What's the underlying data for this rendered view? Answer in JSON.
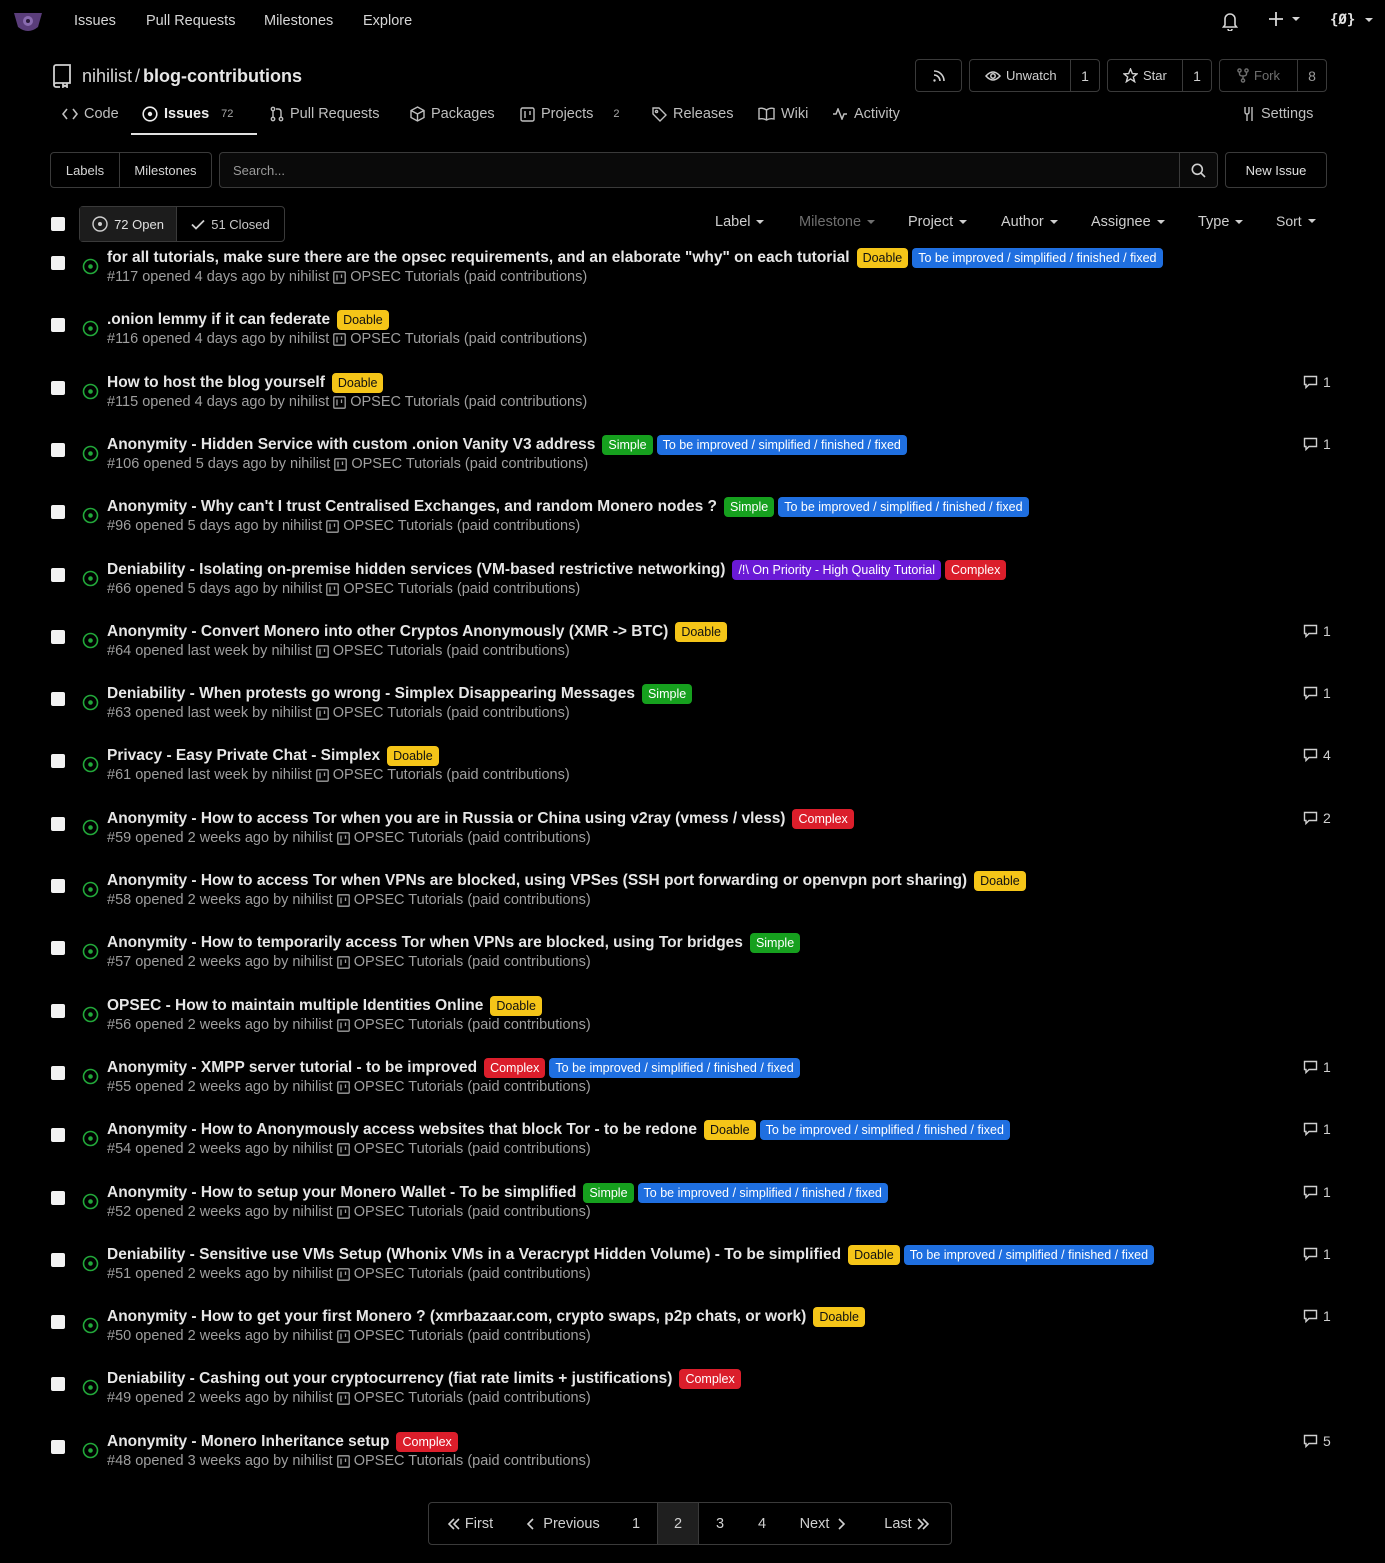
{
  "nav": {
    "links": [
      "Issues",
      "Pull Requests",
      "Milestones",
      "Explore"
    ],
    "user_icon_text": "{Ø}"
  },
  "repo": {
    "owner": "nihilist",
    "separator": "/",
    "name": "blog-contributions",
    "unwatch_label": "Unwatch",
    "watch_count": "1",
    "star_label": "Star",
    "star_count": "1",
    "fork_label": "Fork",
    "fork_count": "8"
  },
  "tabs": {
    "code": "Code",
    "issues": "Issues",
    "issues_count": "72",
    "pulls": "Pull Requests",
    "packages": "Packages",
    "projects": "Projects",
    "projects_count": "2",
    "releases": "Releases",
    "wiki": "Wiki",
    "activity": "Activity",
    "settings": "Settings"
  },
  "toolbar": {
    "labels": "Labels",
    "milestones": "Milestones",
    "search_placeholder": "Search...",
    "new_issue": "New Issue"
  },
  "filters": {
    "open": "72 Open",
    "closed": "51 Closed",
    "label": "Label",
    "milestone": "Milestone",
    "project": "Project",
    "author": "Author",
    "assignee": "Assignee",
    "type": "Type",
    "sort": "Sort"
  },
  "issues": [
    {
      "title": "for all tutorials, make sure there are the opsec requirements, and an elaborate \"why\" on each tutorial",
      "labels": [
        [
          "Doable",
          "doable"
        ],
        [
          "To be improved / simplified / finished / fixed",
          "improve"
        ]
      ],
      "meta": "#117 opened 4 days ago by nihilist",
      "project": "OPSEC Tutorials (paid contributions)",
      "comments": ""
    },
    {
      "title": ".onion lemmy if it can federate",
      "labels": [
        [
          "Doable",
          "doable"
        ]
      ],
      "meta": "#116 opened 4 days ago by nihilist",
      "project": "OPSEC Tutorials (paid contributions)",
      "comments": ""
    },
    {
      "title": "How to host the blog yourself",
      "labels": [
        [
          "Doable",
          "doable"
        ]
      ],
      "meta": "#115 opened 4 days ago by nihilist",
      "project": "OPSEC Tutorials (paid contributions)",
      "comments": "1"
    },
    {
      "title": "Anonymity - Hidden Service with custom .onion Vanity V3 address",
      "labels": [
        [
          "Simple",
          "simple"
        ],
        [
          "To be improved / simplified / finished / fixed",
          "improve"
        ]
      ],
      "meta": "#106 opened 5 days ago by nihilist",
      "project": "OPSEC Tutorials (paid contributions)",
      "comments": "1"
    },
    {
      "title": "Anonymity - Why can't I trust Centralised Exchanges, and random Monero nodes ?",
      "labels": [
        [
          "Simple",
          "simple"
        ],
        [
          "To be improved / simplified / finished / fixed",
          "improve"
        ]
      ],
      "meta": "#96 opened 5 days ago by nihilist",
      "project": "OPSEC Tutorials (paid contributions)",
      "comments": ""
    },
    {
      "title": "Deniability - Isolating on-premise hidden services (VM-based restrictive networking)",
      "labels": [
        [
          "/!\\ On Priority - High Quality Tutorial",
          "priority"
        ],
        [
          "Complex",
          "complex"
        ]
      ],
      "meta": "#66 opened 5 days ago by nihilist",
      "project": "OPSEC Tutorials (paid contributions)",
      "comments": ""
    },
    {
      "title": "Anonymity - Convert Monero into other Cryptos Anonymously (XMR -> BTC)",
      "labels": [
        [
          "Doable",
          "doable"
        ]
      ],
      "meta": "#64 opened last week by nihilist",
      "project": "OPSEC Tutorials (paid contributions)",
      "comments": "1"
    },
    {
      "title": "Deniability - When protests go wrong - Simplex Disappearing Messages",
      "labels": [
        [
          "Simple",
          "simple"
        ]
      ],
      "meta": "#63 opened last week by nihilist",
      "project": "OPSEC Tutorials (paid contributions)",
      "comments": "1"
    },
    {
      "title": "Privacy - Easy Private Chat - Simplex",
      "labels": [
        [
          "Doable",
          "doable"
        ]
      ],
      "meta": "#61 opened last week by nihilist",
      "project": "OPSEC Tutorials (paid contributions)",
      "comments": "4"
    },
    {
      "title": "Anonymity - How to access Tor when you are in Russia or China using v2ray (vmess / vless)",
      "labels": [
        [
          "Complex",
          "complex"
        ]
      ],
      "meta": "#59 opened 2 weeks ago by nihilist",
      "project": "OPSEC Tutorials (paid contributions)",
      "comments": "2"
    },
    {
      "title": "Anonymity - How to access Tor when VPNs are blocked, using VPSes (SSH port forwarding or openvpn port sharing)",
      "labels": [
        [
          "Doable",
          "doable"
        ]
      ],
      "meta": "#58 opened 2 weeks ago by nihilist",
      "project": "OPSEC Tutorials (paid contributions)",
      "comments": ""
    },
    {
      "title": "Anonymity - How to temporarily access Tor when VPNs are blocked, using Tor bridges",
      "labels": [
        [
          "Simple",
          "simple"
        ]
      ],
      "meta": "#57 opened 2 weeks ago by nihilist",
      "project": "OPSEC Tutorials (paid contributions)",
      "comments": ""
    },
    {
      "title": "OPSEC - How to maintain multiple Identities Online",
      "labels": [
        [
          "Doable",
          "doable"
        ]
      ],
      "meta": "#56 opened 2 weeks ago by nihilist",
      "project": "OPSEC Tutorials (paid contributions)",
      "comments": ""
    },
    {
      "title": "Anonymity - XMPP server tutorial - to be improved",
      "labels": [
        [
          "Complex",
          "complex"
        ],
        [
          "To be improved / simplified / finished / fixed",
          "improve"
        ]
      ],
      "meta": "#55 opened 2 weeks ago by nihilist",
      "project": "OPSEC Tutorials (paid contributions)",
      "comments": "1"
    },
    {
      "title": "Anonymity - How to Anonymously access websites that block Tor - to be redone",
      "labels": [
        [
          "Doable",
          "doable"
        ],
        [
          "To be improved / simplified / finished / fixed",
          "improve"
        ]
      ],
      "meta": "#54 opened 2 weeks ago by nihilist",
      "project": "OPSEC Tutorials (paid contributions)",
      "comments": "1"
    },
    {
      "title": "Anonymity - How to setup your Monero Wallet - To be simplified",
      "labels": [
        [
          "Simple",
          "simple"
        ],
        [
          "To be improved / simplified / finished / fixed",
          "improve"
        ]
      ],
      "meta": "#52 opened 2 weeks ago by nihilist",
      "project": "OPSEC Tutorials (paid contributions)",
      "comments": "1"
    },
    {
      "title": "Deniability - Sensitive use VMs Setup (Whonix VMs in a Veracrypt Hidden Volume) - To be simplified",
      "labels": [
        [
          "Doable",
          "doable"
        ],
        [
          "To be improved / simplified / finished / fixed",
          "improve"
        ]
      ],
      "meta": "#51 opened 2 weeks ago by nihilist",
      "project": "OPSEC Tutorials (paid contributions)",
      "comments": "1"
    },
    {
      "title": "Anonymity - How to get your first Monero ? (xmrbazaar.com, crypto swaps, p2p chats, or work)",
      "labels": [
        [
          "Doable",
          "doable"
        ]
      ],
      "meta": "#50 opened 2 weeks ago by nihilist",
      "project": "OPSEC Tutorials (paid contributions)",
      "comments": "1"
    },
    {
      "title": "Deniability - Cashing out your cryptocurrency (fiat rate limits + justifications)",
      "labels": [
        [
          "Complex",
          "complex"
        ]
      ],
      "meta": "#49 opened 2 weeks ago by nihilist",
      "project": "OPSEC Tutorials (paid contributions)",
      "comments": ""
    },
    {
      "title": "Anonymity - Monero Inheritance setup",
      "labels": [
        [
          "Complex",
          "complex"
        ]
      ],
      "meta": "#48 opened 3 weeks ago by nihilist",
      "project": "OPSEC Tutorials (paid contributions)",
      "comments": "5"
    }
  ],
  "pagination": {
    "first": "First",
    "previous": "Previous",
    "pages": [
      "1",
      "2",
      "3",
      "4"
    ],
    "current": "2",
    "next": "Next",
    "last": "Last"
  }
}
